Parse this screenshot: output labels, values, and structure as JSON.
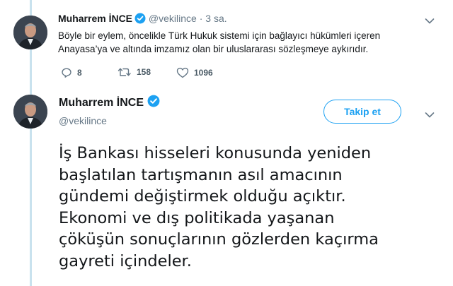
{
  "thread": {
    "reply": {
      "author": {
        "name": "Muharrem İNCE",
        "handle": "@vekilince",
        "separator": "·",
        "time": "3 sa."
      },
      "text_lines": [
        "Böyle bir eylem, öncelikle Türk Hukuk sistemi için bağlayıcı hükümleri içeren",
        "Anayasa’ya ve altında imzamız olan bir uluslararası sözleşmeye aykırıdır."
      ],
      "actions": {
        "replies": "8",
        "retweets": "158",
        "likes": "1096"
      }
    },
    "main": {
      "author": {
        "name": "Muharrem İNCE",
        "handle": "@vekilince"
      },
      "follow_label": "Takip et",
      "text_lines": [
        "İş Bankası hisseleri konusunda yeniden",
        "başlatılan tartışmanın asıl amacının",
        "gündemi değiştirmek olduğu açıktır.",
        "Ekonomi ve dış politikada yaşanan",
        "çöküşün sonuçlarının gözlerden kaçırma",
        "gayreti içindeler."
      ]
    }
  },
  "colors": {
    "accent": "#1da1f2",
    "muted": "#657786",
    "thread_line": "#c9e2ee"
  },
  "icons": [
    "verified-badge-icon",
    "reply-icon",
    "retweet-icon",
    "like-icon",
    "chevron-down-icon"
  ]
}
